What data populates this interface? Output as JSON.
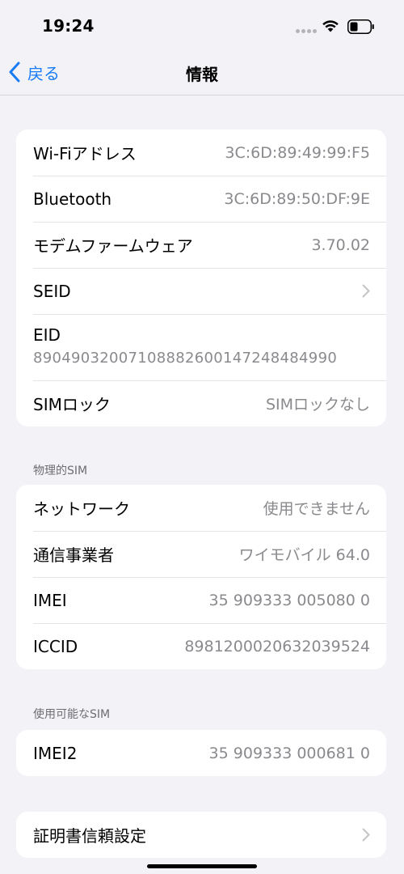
{
  "status_bar": {
    "time": "19:24"
  },
  "nav": {
    "back_label": "戻る",
    "title": "情報"
  },
  "group_main": {
    "rows": [
      {
        "label": "Wi-Fiアドレス",
        "value": "3C:6D:89:49:99:F5"
      },
      {
        "label": "Bluetooth",
        "value": "3C:6D:89:50:DF:9E"
      },
      {
        "label": "モデムファームウェア",
        "value": "3.70.02"
      },
      {
        "label": "SEID"
      },
      {
        "label": "EID",
        "value": "89049032007108882600147248484990"
      },
      {
        "label": "SIMロック",
        "value": "SIMロックなし"
      }
    ]
  },
  "physical_sim": {
    "header": "物理的SIM",
    "rows": [
      {
        "label": "ネットワーク",
        "value": "使用できません"
      },
      {
        "label": "通信事業者",
        "value": "ワイモバイル 64.0"
      },
      {
        "label": "IMEI",
        "value": "35 909333 005080 0"
      },
      {
        "label": "ICCID",
        "value": "8981200020632039524"
      }
    ]
  },
  "available_sim": {
    "header": "使用可能なSIM",
    "rows": [
      {
        "label": "IMEI2",
        "value": "35 909333 000681 0"
      }
    ]
  },
  "certificate": {
    "label": "証明書信頼設定"
  },
  "colors": {
    "accent": "#1a7cf5",
    "background": "#f2f2f7",
    "secondary_text": "#8a8a8e"
  },
  "icons": {
    "back": "chevron-left-icon",
    "disclosure": "chevron-right-icon",
    "wifi": "wifi-icon",
    "battery": "battery-icon"
  }
}
